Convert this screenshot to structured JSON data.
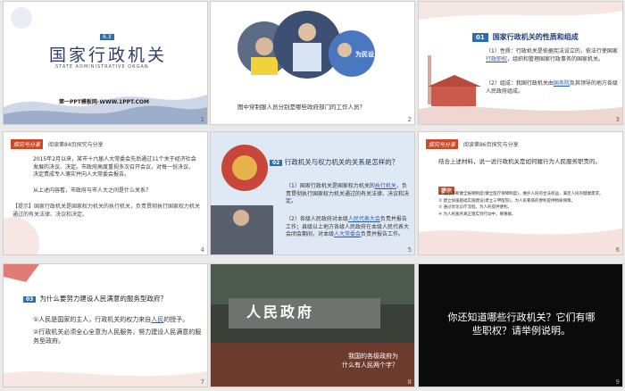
{
  "slides": [
    {
      "id": 1,
      "number": "1",
      "badge": "6.3",
      "title": "国家行政机关",
      "subtitle": "STATE ADMINISTRATIVE ORGAN",
      "footer": "第一PPT模板网-WWW.1PPT.COM"
    },
    {
      "id": 2,
      "number": "2",
      "caption": "图中穿制服人员分别是哪些政府部门的工作人员？",
      "photo_text": "为民设"
    },
    {
      "id": 3,
      "number": "3",
      "badge": "01",
      "heading": "国家行政机关的性质和组成",
      "p1_prefix": "（1）性质：行政机关是依据宪法设立的，依法行使国家",
      "p1_link": "行政职权",
      "p1_suffix": "，组织和管理国家行政事务的国家机关。",
      "p2_prefix": "（2）组成：我国行政机关由",
      "p2_link": "国务院",
      "p2_suffix": "及其领导的地方各级人民政府组成。"
    },
    {
      "id": 4,
      "number": "4",
      "label": "探究与分享",
      "top_title": "阅读第84页探究与分享",
      "para": "2015年2月以来，某市十六届人大常委会先后通过11个关于经济社会发展的决议、决定。市政府高度重视多次召开会议，对每一份决议、决定责成专人落实并向人大常委会报告。",
      "question": "从上述内容看，市政府与市人大之间是什么关系？",
      "tip": "【提示】国家行政机关是国家权力机关的执行机关，负责贯彻执行国家权力机关通过的有关法律、决议和决定。"
    },
    {
      "id": 5,
      "number": "5",
      "badge": "02",
      "question": "行政机关与权力机关的关系是怎样的？",
      "b1_prefix": "（1）国家行政机关是国家权力机关的",
      "b1_link": "执行机关",
      "b1_suffix": "，负责贯彻执行国家权力机关通过的有关法律、决议和决定。",
      "b2_prefix": "（2）各级人民政府对本级",
      "b2_link": "人民代表大会",
      "b2_mid": "负责并报告工作；县级以上地方各级人民政府在本级人民代表大会闭会期间，对本级",
      "b2_link2": "人大常委会",
      "b2_suffix": "负责并报告工作。"
    },
    {
      "id": 6,
      "number": "6",
      "label": "探究与分享",
      "top_title": "阅读第86页探究与分享",
      "question": "结合上述材料，说一说行政机关是如何履行为人民服务职责的。",
      "tip_label": "提示",
      "items": [
        "通过不断健全报销制度(健全医疗保障制度)，维护人民的合法权益，满足人民的健康需求。",
        "建立加强基础实施建设(建立三甲医院)，为人民看病的便利提供物质保障。",
        "通过优化诊疗流程，为人民提供便利。",
        "为人民服务真正落实到行动中，尊重群。"
      ]
    },
    {
      "id": 7,
      "number": "7",
      "badge": "03",
      "question": "为什么要努力建设人民满意的服务型政府？",
      "a1_prefix": "①人民是国家的主人，行政机关的权力来自",
      "a1_link": "人民",
      "a1_suffix": "的授予。",
      "a2": "②行政机关必须全心全意为人民服务，努力建设人民满意的服务型政府。"
    },
    {
      "id": 8,
      "number": "8",
      "sign": "人民政府",
      "caption_line1": "我国的各级政府为",
      "caption_line2": "什么有人民两个字？"
    },
    {
      "id": 9,
      "number": "9",
      "text": "你还知道哪些行政机关？它们有哪些职权？请举例说明。"
    }
  ],
  "colors": {
    "accent_red": "#c0392b",
    "accent_blue": "#2f6db3",
    "bg": "#e9e9e9"
  }
}
